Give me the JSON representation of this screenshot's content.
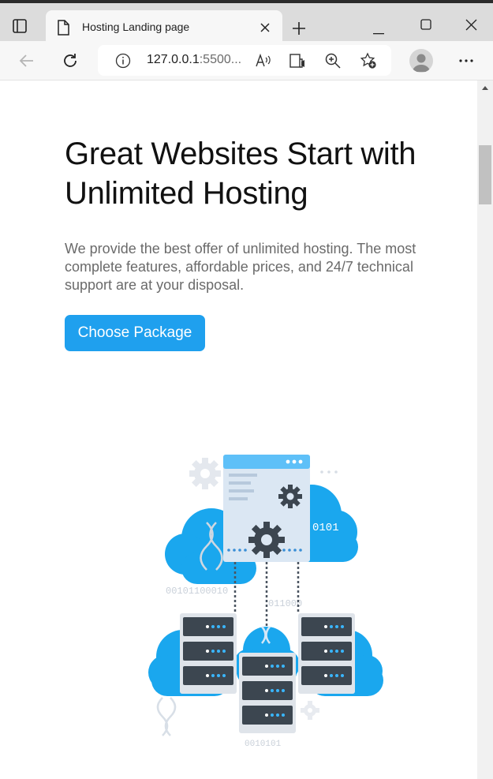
{
  "browser": {
    "tab": {
      "title": "Hosting Landing page"
    },
    "address": {
      "url_main": "127.0.0.1",
      "url_rest": ":5500..."
    },
    "icons": [
      "tab-actions-icon",
      "document-icon",
      "close-icon",
      "plus-icon",
      "minimize-icon",
      "maximize-icon",
      "window-close-icon",
      "back-arrow-icon",
      "refresh-icon",
      "info-icon",
      "read-aloud-icon",
      "immersive-reader-icon",
      "zoom-icon",
      "favorites-add-icon",
      "profile-avatar",
      "more-icon"
    ]
  },
  "hero": {
    "title": "Great Websites Start with Unlimited Hosting",
    "text": "We provide the best offer of unlimited hosting. The most complete features, affordable prices, and 24/7 technical support are at your disposal.",
    "cta_label": "Choose Package"
  },
  "illustration": {
    "binary_a": "0101",
    "binary_b": "00101100010",
    "binary_c": "011000",
    "binary_d": "0010101"
  },
  "colors": {
    "accent": "#1fa0ee",
    "cloud": "#1aa7ee",
    "server_dark": "#3c4650"
  }
}
